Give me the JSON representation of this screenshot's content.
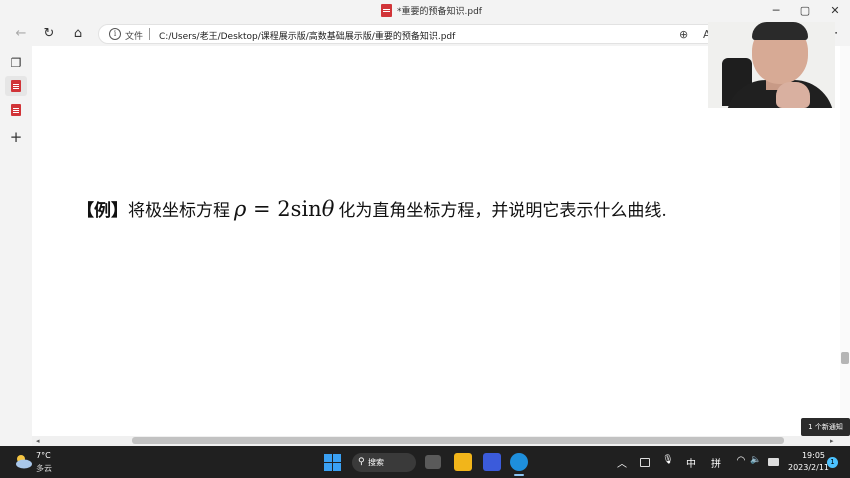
{
  "window": {
    "title": "*重要的预备知识.pdf",
    "minimize_glyph": "─",
    "maximize_glyph": "▢",
    "close_glyph": "✕"
  },
  "toolbar": {
    "back_glyph": "←",
    "refresh_glyph": "↻",
    "home_glyph": "⌂",
    "zoom_glyph": "⊕",
    "read_aloud_glyph": "A",
    "favorites_glyph": "☆",
    "more_glyph": "⋯"
  },
  "address": {
    "info_glyph": "i",
    "label": "文件",
    "url": "C:/Users/老王/Desktop/课程展示版/高数基础展示版/重要的预备知识.pdf"
  },
  "sidebar": {
    "tabs_glyph": "❐",
    "add_glyph": "+"
  },
  "document": {
    "label": "【例】",
    "text_before": "将极坐标方程",
    "formula_rho": "ρ",
    "formula_mid": " = 2sin",
    "formula_theta": "θ",
    "text_after": "化为直角坐标方程，并说明它表示什么曲线."
  },
  "scroll": {
    "left_glyph": "◂",
    "right_glyph": "▸"
  },
  "notification": {
    "text": "1 个新通知"
  },
  "taskbar": {
    "weather_temp": "7°C",
    "weather_desc": "多云",
    "search_label": "搜索",
    "search_glyph": "⚲",
    "tray_chevron": "︿",
    "tray_mic": "🎙",
    "ime_lang": "中",
    "ime_mode": "拼",
    "tray_wifi": "◠",
    "tray_volume": "🔈",
    "clock_time": "19:05",
    "clock_date": "2023/2/11",
    "notification_count": "1"
  },
  "colors": {
    "accent_blue": "#3aa0f3",
    "pdf_red": "#d13438",
    "taskbar_bg": "#202020"
  }
}
